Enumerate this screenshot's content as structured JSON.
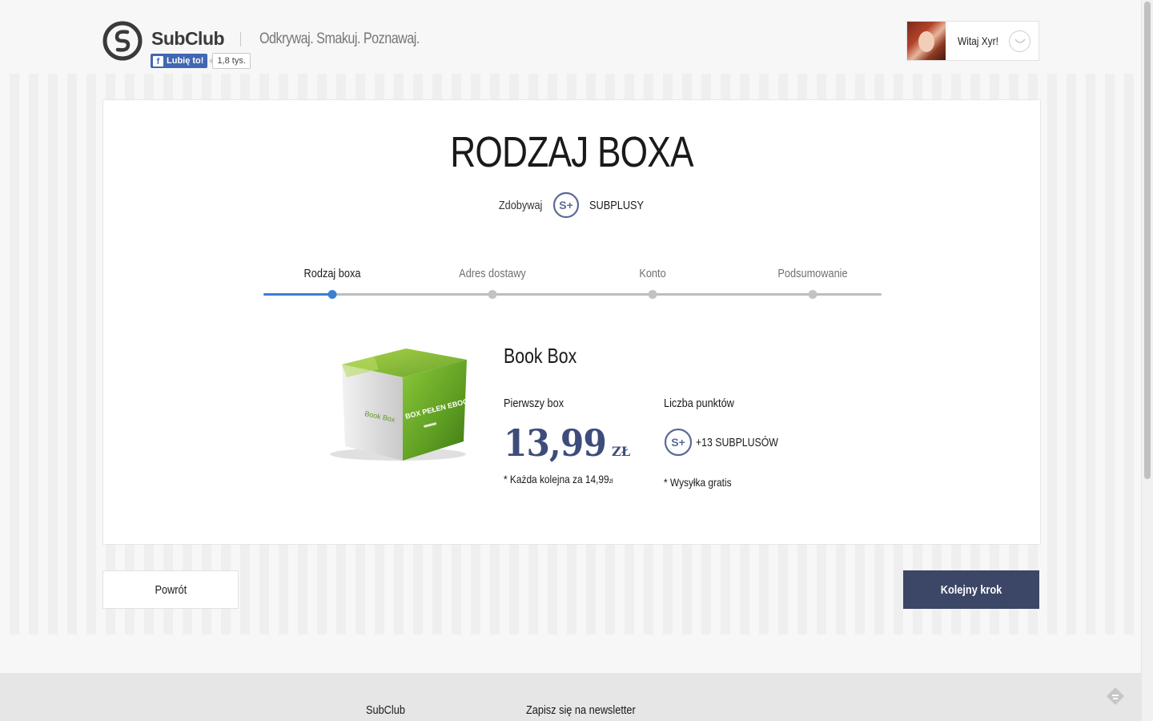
{
  "header": {
    "brand": "SubClub",
    "tagline": "Odkrywaj. Smakuj. Poznawaj.",
    "fb_like_label": "Lubię to!",
    "fb_like_count": "1,8 tys.",
    "greeting": "Witaj Xyr!"
  },
  "card": {
    "title": "RODZAJ BOXA",
    "earn_label": "Zdobywaj",
    "earn_value": "SUBPLUSY",
    "steps": [
      {
        "label": "Rodzaj boxa",
        "active": true
      },
      {
        "label": "Adres dostawy",
        "active": false
      },
      {
        "label": "Konto",
        "active": false
      },
      {
        "label": "Podsumowanie",
        "active": false
      }
    ],
    "product": {
      "name": "Book Box",
      "box_texts": {
        "brand": "Book Box",
        "headline": "BOX PEŁEN EBOOKÓW"
      },
      "first_box_label": "Pierwszy box",
      "price": "13,99",
      "currency": "ZŁ",
      "next_note": "* Każda kolejna za 14,99",
      "next_note_currency": "zł",
      "points_label": "Liczba punktów",
      "points_value": "+13 SUBPLUSÓW",
      "shipping_note": "* Wysyłka gratis"
    }
  },
  "actions": {
    "back": "Powrót",
    "next": "Kolejny krok"
  },
  "footer": {
    "col1": "SubClub",
    "col2": "Zapisz się na newsletter"
  },
  "colors": {
    "accent_blue": "#3b7fd0",
    "price_navy": "#3d4c7a",
    "next_button": "#3c4666",
    "box_green": "#6fae2a"
  },
  "icons": {
    "logo": "subclub-logo-icon",
    "subplus": "subplus-badge-icon",
    "user_menu": "user-menu-icon",
    "footer": "feedly-icon"
  }
}
